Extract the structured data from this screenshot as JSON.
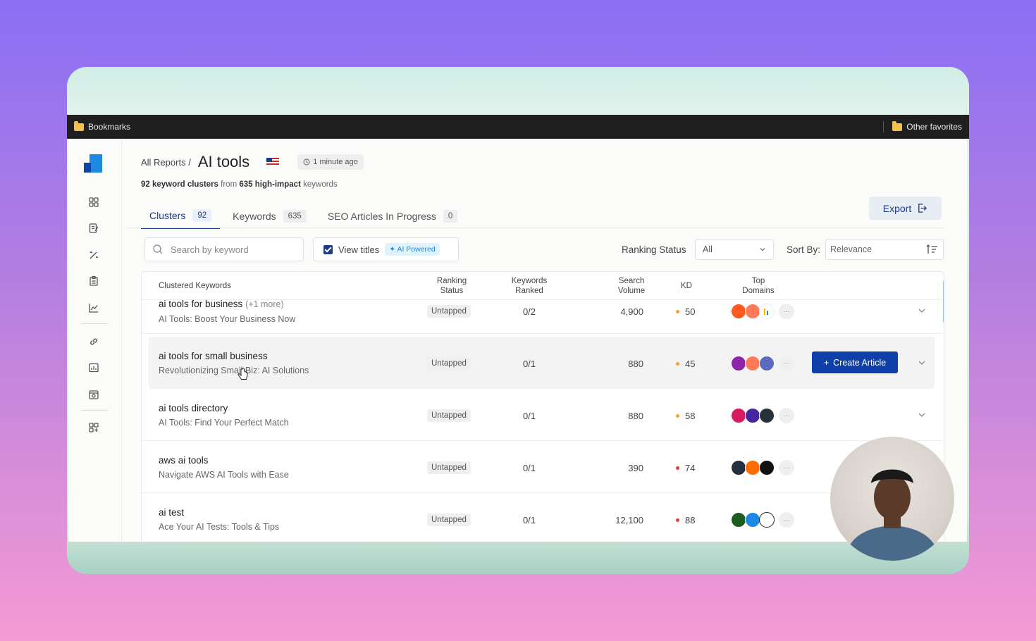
{
  "bookmarks_bar": {
    "left": "Bookmarks",
    "right": "Other favorites"
  },
  "breadcrumb": {
    "parent": "All Reports /",
    "title": "AI tools"
  },
  "updated": "1 minute ago",
  "summary": {
    "clusters": "92 keyword clusters",
    "from": "from",
    "keywords": "635 high-impact",
    "suffix": "keywords"
  },
  "tabs": [
    {
      "label": "Clusters",
      "count": "92"
    },
    {
      "label": "Keywords",
      "count": "635"
    },
    {
      "label": "SEO Articles In Progress",
      "count": "0"
    }
  ],
  "export_label": "Export",
  "search": {
    "placeholder": "Search by keyword"
  },
  "view_titles": {
    "label": "View titles",
    "badge": "AI Powered"
  },
  "ranking_status": {
    "label": "Ranking Status",
    "value": "All"
  },
  "sort_by": {
    "label": "Sort By:",
    "value": "Relevance"
  },
  "columns": {
    "keywords": "Clustered Keywords",
    "ranking_status": [
      "Ranking",
      "Status"
    ],
    "keywords_ranked": [
      "Keywords",
      "Ranked"
    ],
    "search_volume": [
      "Search",
      "Volume"
    ],
    "kd": "KD",
    "top_domains": [
      "Top",
      "Domains"
    ]
  },
  "rows": [
    {
      "keyword": "ai tools for business",
      "more": "(+1 more)",
      "subtitle": "AI Tools: Boost Your Business Now",
      "status": "Untapped",
      "ranked": "0/2",
      "volume": "4,900",
      "kd": "50",
      "kd_color": "#f5a623"
    },
    {
      "keyword": "ai tools for small business",
      "more": "",
      "subtitle": "Revolutionizing Small Biz: AI Solutions",
      "status": "Untapped",
      "ranked": "0/1",
      "volume": "880",
      "kd": "45",
      "kd_color": "#f5a623"
    },
    {
      "keyword": "ai tools directory",
      "more": "",
      "subtitle": "AI Tools: Find Your Perfect Match",
      "status": "Untapped",
      "ranked": "0/1",
      "volume": "880",
      "kd": "58",
      "kd_color": "#f5a623"
    },
    {
      "keyword": "aws ai tools",
      "more": "",
      "subtitle": "Navigate AWS AI Tools with Ease",
      "status": "Untapped",
      "ranked": "0/1",
      "volume": "390",
      "kd": "74",
      "kd_color": "#e53935"
    },
    {
      "keyword": "ai test",
      "more": "",
      "subtitle": "Ace Your AI Tests: Tools & Tips",
      "status": "Untapped",
      "ranked": "0/1",
      "volume": "12,100",
      "kd": "88",
      "kd_color": "#e53935"
    }
  ],
  "create_article_label": "Create Article",
  "colors": {
    "primary": "#0f3fa8",
    "accent": "#1e88e5"
  }
}
